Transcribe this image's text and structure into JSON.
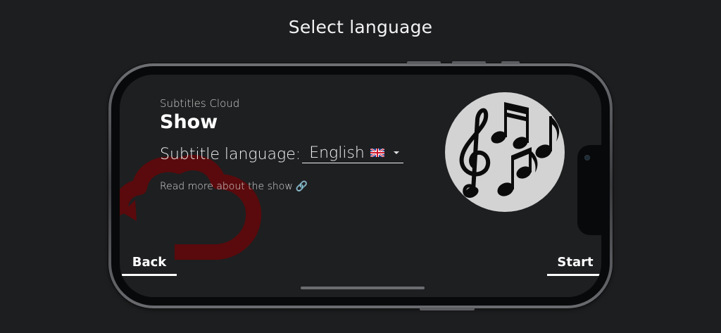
{
  "header": {
    "title": "Select language"
  },
  "show": {
    "provider": "Subtitles Cloud",
    "title": "Show",
    "subtitle_label": "Subtitle language:",
    "selected_language": "English",
    "language_flag": "uk-flag-icon",
    "read_more": "Read more about the show",
    "link_icon": "🔗"
  },
  "nav": {
    "back_label": "Back",
    "start_label": "Start"
  },
  "colors": {
    "background": "#1d1e20",
    "screen": "#1e1f21",
    "cloud_accent": "#5a0a0c",
    "music_circle": "#d3d3d3",
    "text": "#ffffff"
  }
}
